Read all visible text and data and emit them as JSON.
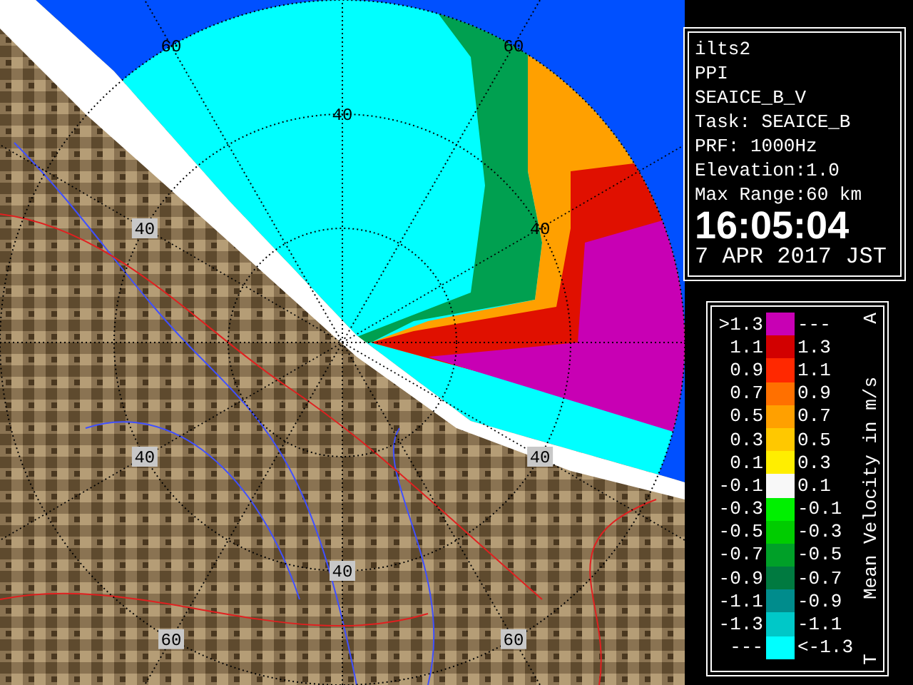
{
  "radar_map": {
    "range_labels": [
      {
        "text": "60",
        "boxed": false
      },
      {
        "text": "60",
        "boxed": false
      },
      {
        "text": "40",
        "boxed": false
      },
      {
        "text": "40",
        "boxed": true
      },
      {
        "text": "40",
        "boxed": false
      },
      {
        "text": "40",
        "boxed": true
      },
      {
        "text": "40",
        "boxed": true
      },
      {
        "text": "40",
        "boxed": true
      },
      {
        "text": "60",
        "boxed": true
      },
      {
        "text": "60",
        "boxed": true
      }
    ]
  },
  "info": {
    "lines": [
      "ilts2",
      "PPI",
      "SEAICE_B_V",
      "Task: SEAICE_B",
      "PRF: 1000Hz",
      "Elevation:1.0",
      "Max Range:60 km"
    ],
    "time": "16:05:04",
    "date": "7 APR 2017 JST"
  },
  "legend": {
    "title": "Mean Velocity in m/s",
    "top_mark": "A",
    "bottom_mark": "T",
    "rows": [
      {
        "low": ">1.3",
        "high": "---",
        "color": "#c800b4"
      },
      {
        "low": "1.1",
        "high": "1.3",
        "color": "#d20000"
      },
      {
        "low": "0.9",
        "high": "1.1",
        "color": "#ff2800"
      },
      {
        "low": "0.7",
        "high": "0.9",
        "color": "#ff7000"
      },
      {
        "low": "0.5",
        "high": "0.7",
        "color": "#ffa000"
      },
      {
        "low": "0.3",
        "high": "0.5",
        "color": "#ffc800"
      },
      {
        "low": "0.1",
        "high": "0.3",
        "color": "#ffee00"
      },
      {
        "low": "-0.1",
        "high": "0.1",
        "color": "#f8f8f8"
      },
      {
        "low": "-0.3",
        "high": "-0.1",
        "color": "#00f000"
      },
      {
        "low": "-0.5",
        "high": "-0.3",
        "color": "#00cc00"
      },
      {
        "low": "-0.7",
        "high": "-0.5",
        "color": "#00a028"
      },
      {
        "low": "-0.9",
        "high": "-0.7",
        "color": "#007a40"
      },
      {
        "low": "-1.1",
        "high": "-0.9",
        "color": "#008c8c"
      },
      {
        "low": "-1.3",
        "high": "-1.1",
        "color": "#00c8c8"
      },
      {
        "low": "---",
        "high": "<-1.3",
        "color": "#00ffff"
      }
    ]
  }
}
